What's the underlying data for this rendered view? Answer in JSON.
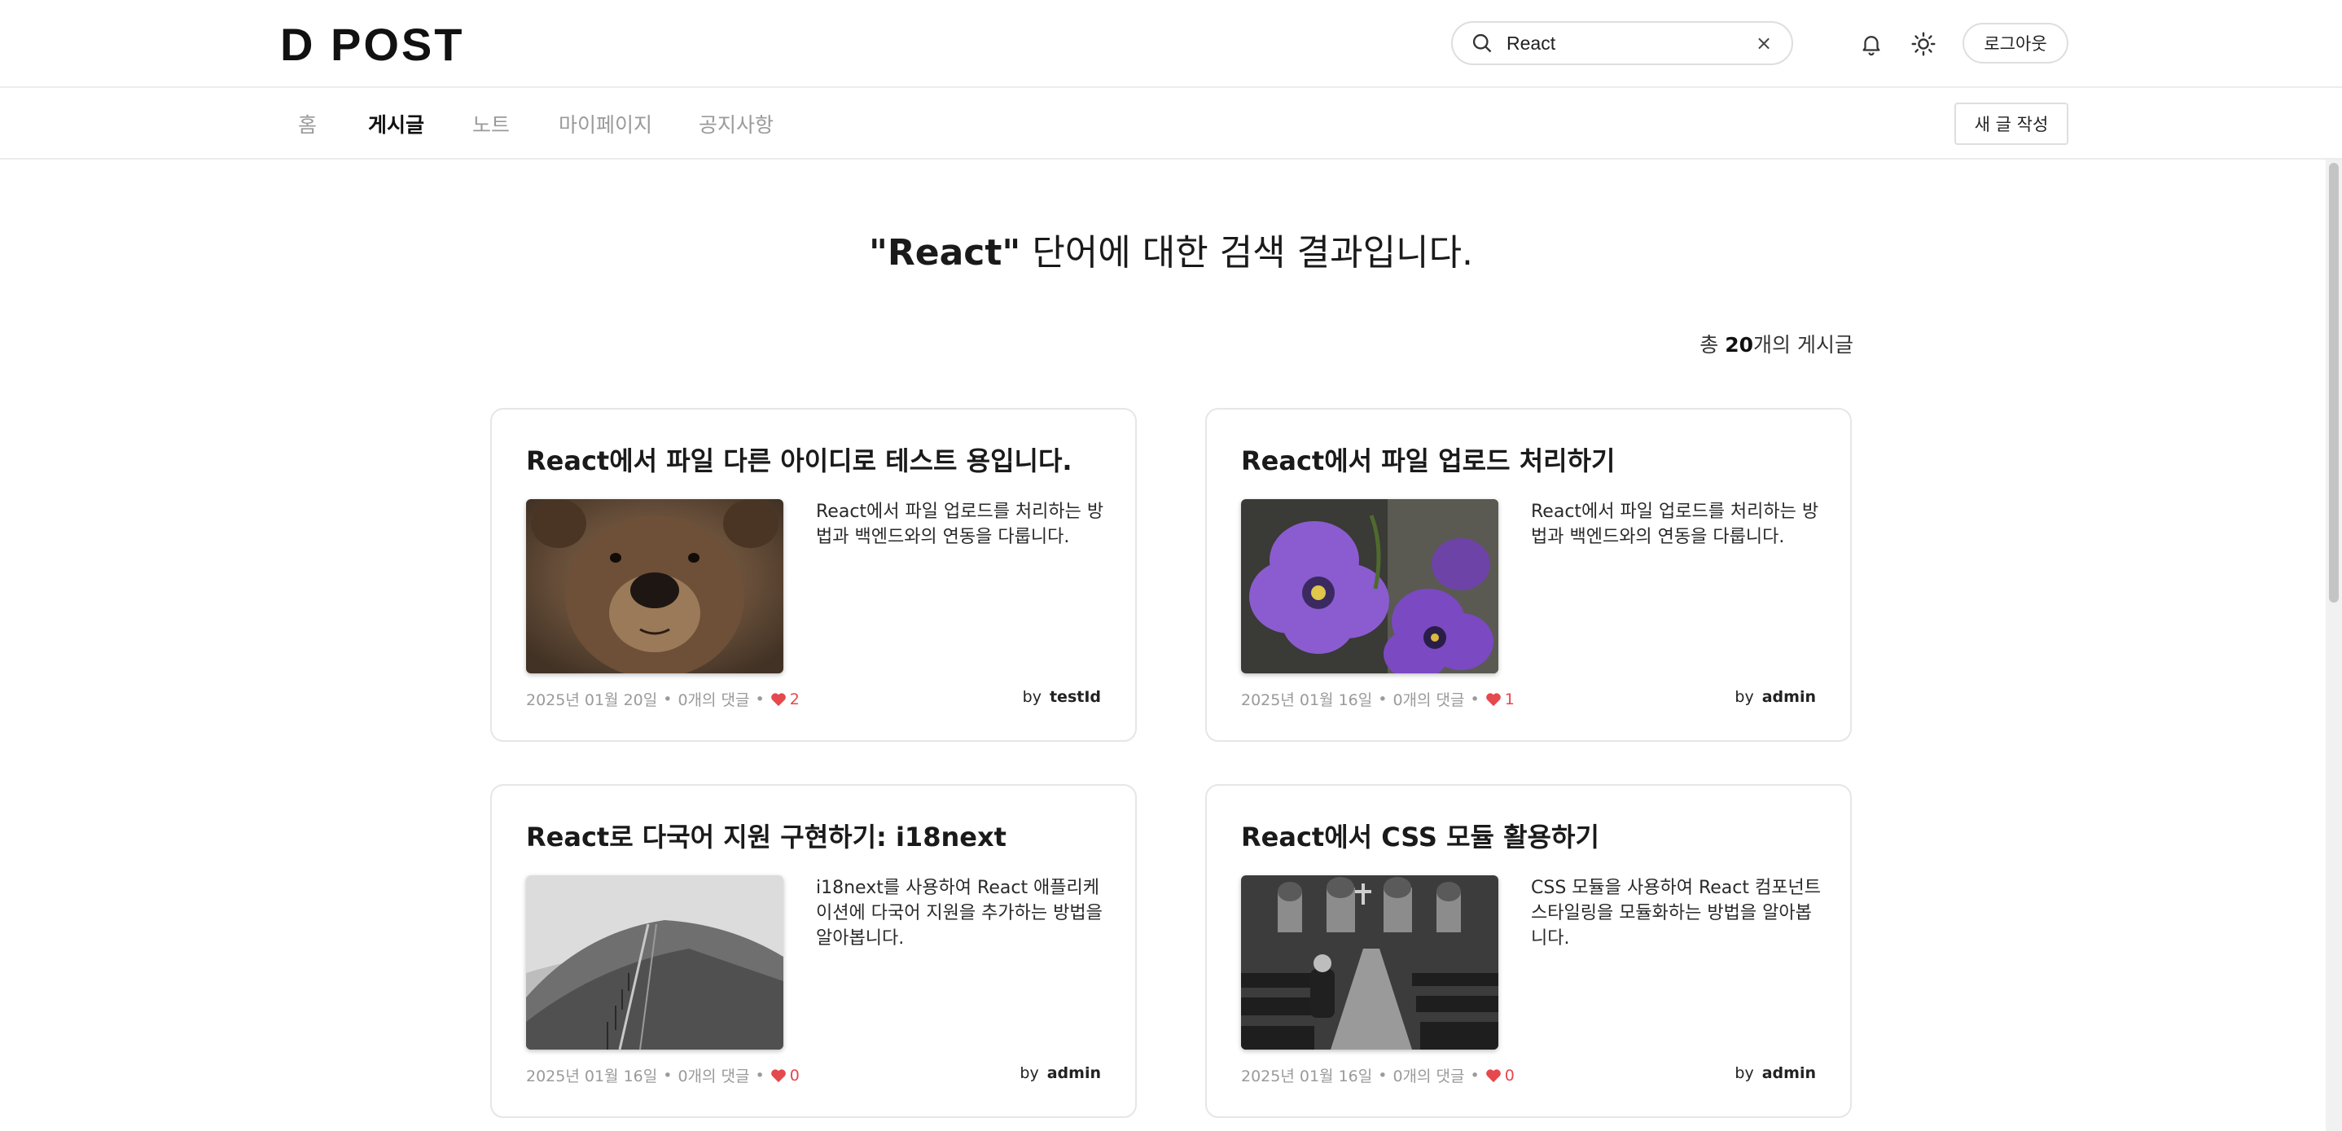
{
  "header": {
    "logo": "D POST",
    "search_value": "React",
    "clear_glyph": "×",
    "logout_label": "로그아웃",
    "icons": [
      "search-icon",
      "close-icon",
      "bell-icon",
      "sun-icon"
    ]
  },
  "nav": {
    "items": [
      {
        "label": "홈",
        "active": false
      },
      {
        "label": "게시글",
        "active": true
      },
      {
        "label": "노트",
        "active": false
      },
      {
        "label": "마이페이지",
        "active": false
      },
      {
        "label": "공지사항",
        "active": false
      }
    ],
    "new_post_label": "새 글 작성"
  },
  "result": {
    "query": "\"React\"",
    "suffix": " 단어에 대한 검색 결과입니다.",
    "count_prefix": "총 ",
    "count": "20",
    "count_suffix": "개의 게시글"
  },
  "posts": [
    {
      "title": "React에서 파일 다른 아이디로 테스트 용입니다.",
      "description": "React에서 파일 업로드를 처리하는 방법과 백엔드와의 연동을 다룹니다.",
      "date": "2025년 01월 20일",
      "comments": "0개의 댓글",
      "likes": "2",
      "by_label": "by",
      "author": "testId",
      "image": "bear"
    },
    {
      "title": "React에서 파일 업로드 처리하기",
      "description": "React에서 파일 업로드를 처리하는 방법과 백엔드와의 연동을 다룹니다.",
      "date": "2025년 01월 16일",
      "comments": "0개의 댓글",
      "likes": "1",
      "by_label": "by",
      "author": "admin",
      "image": "purple-flowers"
    },
    {
      "title": "React로 다국어 지원 구현하기: i18next",
      "description": "i18next를 사용하여 React 애플리케이션에 다국어 지원을 추가하는 방법을 알아봅니다.",
      "date": "2025년 01월 16일",
      "comments": "0개의 댓글",
      "likes": "0",
      "by_label": "by",
      "author": "admin",
      "image": "hillside-path"
    },
    {
      "title": "React에서 CSS 모듈 활용하기",
      "description": "CSS 모듈을 사용하여 React 컴포넌트 스타일링을 모듈화하는 방법을 알아봅니다.",
      "date": "2025년 01월 16일",
      "comments": "0개의 댓글",
      "likes": "0",
      "by_label": "by",
      "author": "admin",
      "image": "church-interior"
    }
  ],
  "colors": {
    "heart": "#e5484d",
    "muted": "#9a9a9a",
    "border": "#e6e6e6"
  }
}
